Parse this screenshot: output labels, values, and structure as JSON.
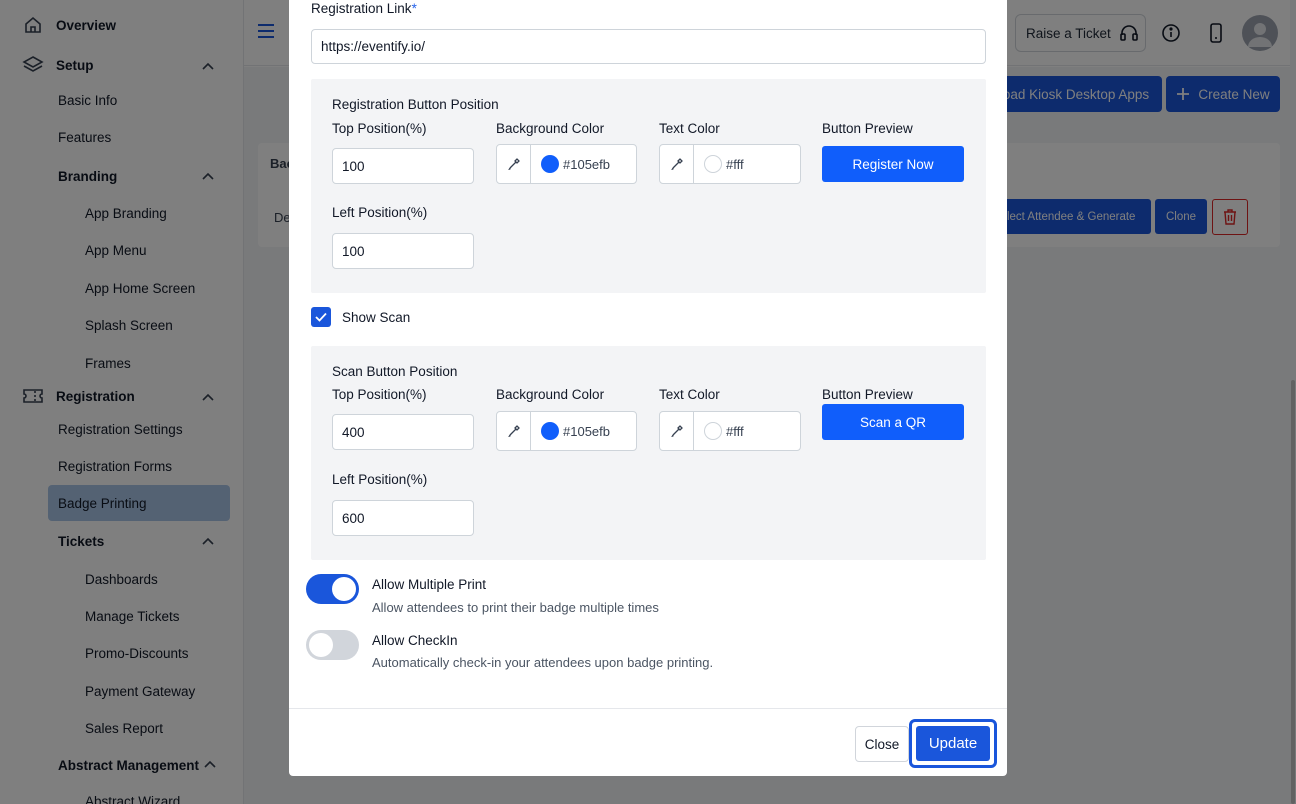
{
  "sidebar": {
    "overview": "Overview",
    "setup": "Setup",
    "basic_info": "Basic Info",
    "features": "Features",
    "branding": "Branding",
    "app_branding": "App Branding",
    "app_menu": "App Menu",
    "app_home_screen": "App Home Screen",
    "splash_screen": "Splash Screen",
    "frames": "Frames",
    "registration": "Registration",
    "registration_settings": "Registration Settings",
    "registration_forms": "Registration Forms",
    "badge_printing": "Badge Printing",
    "tickets": "Tickets",
    "dashboards": "Dashboards",
    "manage_tickets": "Manage Tickets",
    "promo_discounts": "Promo-Discounts",
    "payment_gateway": "Payment Gateway",
    "sales_report": "Sales Report",
    "abstract_management": "Abstract Management",
    "abstract_wizard": "Abstract Wizard"
  },
  "header": {
    "raise_ticket": "Raise a Ticket"
  },
  "page": {
    "download_kiosk": "oad Kiosk Desktop Apps",
    "create_new": "Create New",
    "table_header": "Bac",
    "row_cell": "De",
    "select_generate": "elect Attendee & Generate",
    "clone": "Clone"
  },
  "modal": {
    "registration_link_label": "Registration Link",
    "required_mark": "*",
    "registration_link_value": "https://eventify.io/",
    "reg_section_title": "Registration Button Position",
    "scan_section_title": "Scan Button Position",
    "top_position_label": "Top Position(%)",
    "left_position_label": "Left Position(%)",
    "background_color_label": "Background Color",
    "text_color_label": "Text Color",
    "button_preview_label": "Button Preview",
    "reg_top_value": "100",
    "reg_left_value": "100",
    "reg_bg_color": "#105efb",
    "reg_text_color": "#fff",
    "reg_preview_text": "Register Now",
    "show_scan_label": "Show Scan",
    "show_scan_checked": true,
    "scan_top_value": "400",
    "scan_left_value": "600",
    "scan_bg_color": "#105efb",
    "scan_text_color": "#fff",
    "scan_preview_text": "Scan a QR",
    "allow_multiple_print_label": "Allow Multiple Print",
    "allow_multiple_print_desc": "Allow attendees to print their badge multiple times",
    "allow_multiple_print_on": true,
    "allow_checkin_label": "Allow CheckIn",
    "allow_checkin_desc": "Automatically check-in your attendees upon badge printing.",
    "allow_checkin_on": false,
    "close_label": "Close",
    "update_label": "Update"
  },
  "colors": {
    "primary": "#1a56db",
    "preview_bg": "#105efb",
    "toggle_off": "#d1d5db"
  }
}
